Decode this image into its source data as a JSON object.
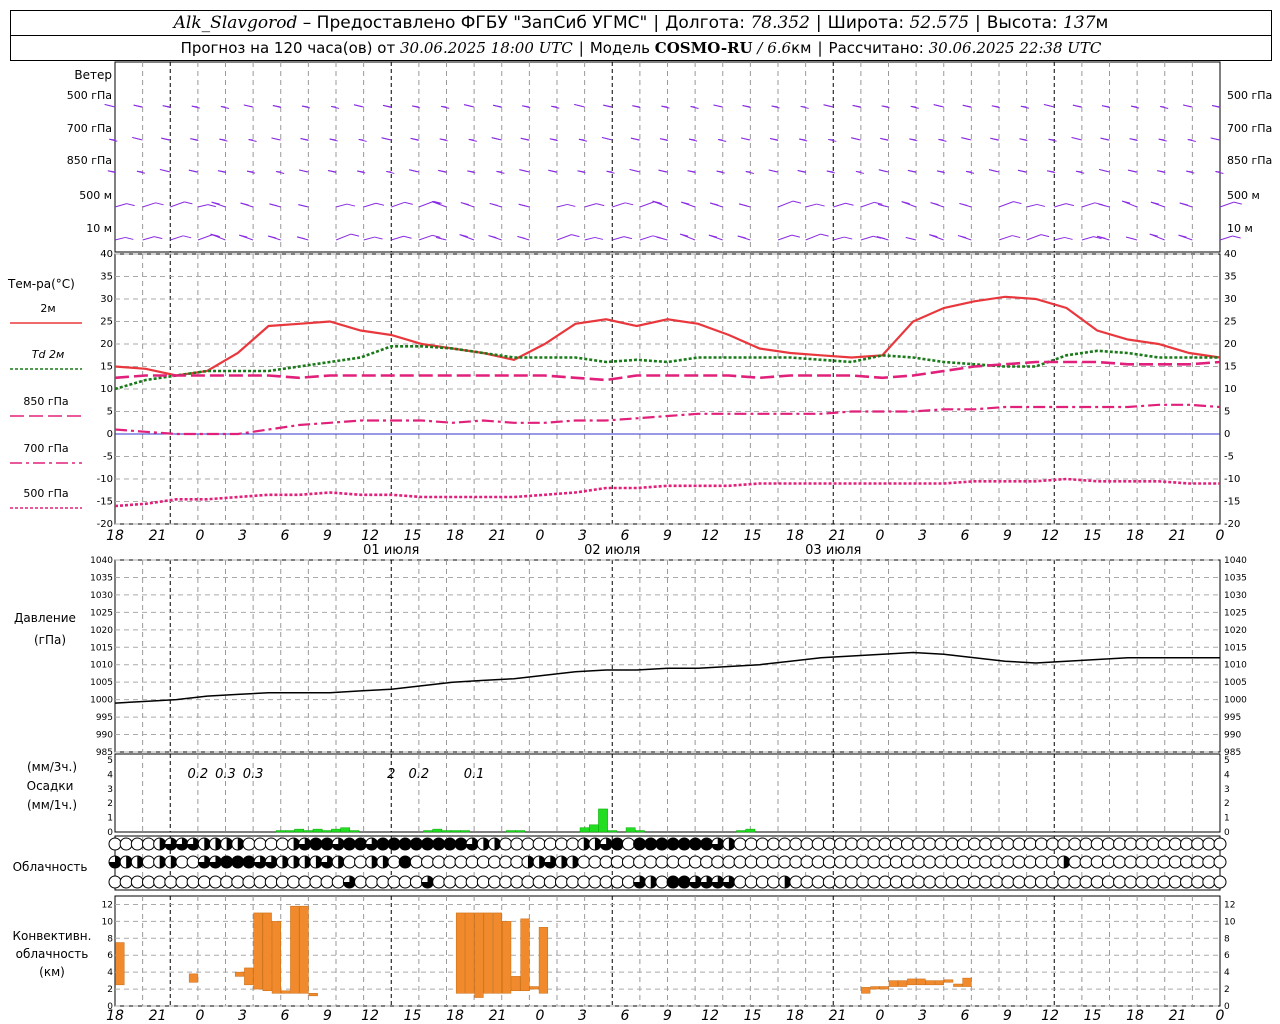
{
  "header": {
    "station": "Alk_Slavgorod",
    "provider": "– Предоставлено ФГБУ \"ЗапСиб УГМС\"",
    "lon_label": "Долгота:",
    "lon_value": "78.352",
    "lat_label": "Широта:",
    "lat_value": "52.575",
    "alt_label": "Высота:",
    "alt_value": "137",
    "alt_unit": "м",
    "forecast_label": "Прогноз на 120 часа(ов) от",
    "forecast_start": "30.06.2025 18:00 UTC",
    "model_label": "Модель",
    "model_name": "COSMO-RU",
    "model_res": "/ 6.6",
    "model_res_unit": "км",
    "computed_label": "Рассчитано:",
    "computed_value": "30.06.2025 22:38 UTC"
  },
  "labels": {
    "wind": "Ветер",
    "wind_levels": [
      "500 гПа",
      "700 гПа",
      "850 гПа",
      "500 м",
      "10  м"
    ],
    "temp_title": "Тем-ра(°C)",
    "temp_legend": [
      "2м",
      "Td  2м",
      "850 гПа",
      "700 гПа",
      "500 гПа"
    ],
    "pressure_title": "Давление",
    "pressure_unit": "(гПа)",
    "precip_unit3": "(мм/3ч.)",
    "precip_title": "Осадки",
    "precip_unit1": "(мм/1ч.)",
    "cloud_title": "Облачность",
    "conv_title": [
      "Конвективн.",
      "облачность",
      "(км)"
    ],
    "time_ticks": [
      "18",
      "21",
      "0",
      "3",
      "6",
      "9",
      "12",
      "15",
      "18",
      "21",
      "0",
      "3",
      "6",
      "9",
      "12",
      "15",
      "18",
      "21",
      "0",
      "3",
      "6",
      "9",
      "12",
      "15",
      "18",
      "21",
      "0"
    ],
    "dates": [
      "01 июля",
      "02 июля",
      "03 июля"
    ],
    "precip_3h_labels": [
      "0.2",
      "0.3",
      "0.3",
      "2",
      "0.2",
      "0.1"
    ]
  },
  "colors": {
    "wind": "#8a2be2",
    "t2m": "#e8383d",
    "td2m": "#1a7a1a",
    "t850": "#e0207a",
    "t700": "#e0207a",
    "t500": "#e0207a",
    "precip": "#22dd22",
    "conv": "#f08a2c",
    "zero_line": "#3333cc"
  },
  "chart_data": [
    {
      "type": "line",
      "title": "Тем-ра(°C)",
      "ylim": [
        -20,
        40
      ],
      "x_hours_from_start": [
        0,
        3,
        6,
        9,
        12,
        15,
        18,
        21,
        24,
        27,
        30,
        33,
        36,
        39,
        42,
        45,
        48,
        51,
        54,
        57,
        60,
        63,
        66,
        69,
        72,
        75,
        78,
        81,
        84,
        87,
        90,
        93,
        96,
        99,
        102,
        105,
        108,
        111,
        114,
        117,
        120
      ],
      "series": [
        {
          "name": "2м",
          "values": [
            15,
            14.5,
            13,
            14,
            18,
            24,
            24.5,
            25,
            23,
            22,
            20,
            19,
            18,
            16.5,
            20,
            24.5,
            25.5,
            24,
            25.5,
            24.5,
            22,
            19,
            18,
            17.5,
            17,
            17.5,
            25,
            28,
            29.5,
            30.5,
            30,
            28,
            23,
            21,
            20,
            18,
            17
          ]
        },
        {
          "name": "Td  2м",
          "values": [
            10,
            12,
            13,
            14,
            14,
            14,
            15,
            16,
            17,
            19.5,
            19.5,
            19,
            18,
            17,
            17,
            17,
            16,
            16.5,
            16,
            17,
            17,
            17,
            17,
            16.5,
            16,
            17.5,
            17,
            16,
            15.5,
            15,
            15,
            17.5,
            18.5,
            18,
            17,
            17,
            17
          ]
        },
        {
          "name": "850 гПа",
          "values": [
            12.5,
            13,
            13,
            13,
            13,
            13,
            12.5,
            13,
            13,
            13,
            13,
            13,
            13,
            13,
            13,
            12.5,
            12,
            13,
            13,
            13,
            13,
            12.5,
            13,
            13,
            13,
            12.5,
            13,
            14,
            15,
            15.5,
            16,
            16,
            16,
            15.5,
            15.5,
            15.5,
            16
          ]
        },
        {
          "name": "700 гПа",
          "values": [
            1,
            0.5,
            0,
            0,
            0,
            1,
            2,
            2.5,
            3,
            3,
            3,
            2.5,
            3,
            2.5,
            2.5,
            3,
            3,
            3.5,
            4,
            4.5,
            4.5,
            4.5,
            4.5,
            4.5,
            5,
            5,
            5,
            5.5,
            5.5,
            6,
            6,
            6,
            6,
            6,
            6.5,
            6.5,
            6
          ]
        },
        {
          "name": "500 гПа",
          "values": [
            -16,
            -15.5,
            -14.5,
            -14.5,
            -14,
            -13.5,
            -13.5,
            -13,
            -13.5,
            -13.5,
            -14,
            -14,
            -14,
            -14,
            -13.5,
            -13,
            -12,
            -12,
            -11.5,
            -11.5,
            -11.5,
            -11,
            -11,
            -11,
            -11,
            -11,
            -11,
            -11,
            -10.5,
            -10.5,
            -10.5,
            -10,
            -10.5,
            -10.5,
            -10.5,
            -11,
            -11
          ]
        }
      ]
    },
    {
      "type": "line",
      "title": "Давление",
      "ylim": [
        985,
        1040
      ],
      "series": [
        {
          "name": "Давление",
          "values": [
            999,
            999.5,
            1000,
            1001,
            1001.5,
            1002,
            1002,
            1002,
            1002.5,
            1003,
            1004,
            1005,
            1005.5,
            1006,
            1007,
            1008,
            1008.5,
            1008.5,
            1009,
            1009,
            1009.5,
            1010,
            1011,
            1012,
            1012.5,
            1013,
            1013.5,
            1013,
            1012,
            1011,
            1010.5,
            1011,
            1011.5,
            1012,
            1012,
            1012,
            1012
          ]
        }
      ]
    },
    {
      "type": "bar",
      "title": "Осадки",
      "ylim": [
        0,
        5
      ],
      "hours": [
        18,
        19,
        20,
        21,
        22,
        23,
        24,
        25,
        26,
        34,
        35,
        36,
        37,
        38,
        43,
        44,
        51,
        52,
        53,
        54,
        56,
        57,
        68,
        69
      ],
      "values": [
        0.1,
        0.1,
        0.2,
        0.1,
        0.2,
        0.1,
        0.2,
        0.3,
        0.1,
        0.1,
        0.2,
        0.1,
        0.1,
        0.1,
        0.1,
        0.1,
        0.3,
        0.5,
        1.6,
        0.1,
        0.3,
        0.1,
        0.1,
        0.2
      ]
    },
    {
      "type": "bar",
      "title": "Конвективн. облачность (км)",
      "ylim": [
        0,
        13
      ],
      "bars": [
        {
          "h": 0,
          "bottom": 2.5,
          "top": 7.5
        },
        {
          "h": 8,
          "bottom": 2.8,
          "top": 3.8
        },
        {
          "h": 13,
          "bottom": 3.5,
          "top": 4
        },
        {
          "h": 14,
          "bottom": 2.5,
          "top": 4.5
        },
        {
          "h": 15,
          "bottom": 2,
          "top": 11
        },
        {
          "h": 16,
          "bottom": 1.8,
          "top": 11
        },
        {
          "h": 17,
          "bottom": 1.5,
          "top": 10
        },
        {
          "h": 18,
          "bottom": 1.5,
          "top": 1.8
        },
        {
          "h": 19,
          "bottom": 1.5,
          "top": 11.8
        },
        {
          "h": 20,
          "bottom": 1.5,
          "top": 11.8
        },
        {
          "h": 21,
          "bottom": 1.2,
          "top": 1.5
        },
        {
          "h": 37,
          "bottom": 1.5,
          "top": 11
        },
        {
          "h": 38,
          "bottom": 1.5,
          "top": 11
        },
        {
          "h": 39,
          "bottom": 1,
          "top": 11
        },
        {
          "h": 40,
          "bottom": 1.5,
          "top": 11
        },
        {
          "h": 41,
          "bottom": 1.5,
          "top": 11
        },
        {
          "h": 42,
          "bottom": 1.5,
          "top": 10
        },
        {
          "h": 43,
          "bottom": 1.8,
          "top": 3.5
        },
        {
          "h": 44,
          "bottom": 1.8,
          "top": 10.3
        },
        {
          "h": 45,
          "bottom": 2,
          "top": 2.3
        },
        {
          "h": 46,
          "bottom": 1.5,
          "top": 9.3
        },
        {
          "h": 81,
          "bottom": 1.5,
          "top": 2.2
        },
        {
          "h": 82,
          "bottom": 2,
          "top": 2.3
        },
        {
          "h": 83,
          "bottom": 2,
          "top": 2.3
        },
        {
          "h": 84,
          "bottom": 2.3,
          "top": 3
        },
        {
          "h": 85,
          "bottom": 2.3,
          "top": 3
        },
        {
          "h": 86,
          "bottom": 2.5,
          "top": 3.2
        },
        {
          "h": 87,
          "bottom": 2.5,
          "top": 3.2
        },
        {
          "h": 88,
          "bottom": 2.5,
          "top": 3
        },
        {
          "h": 89,
          "bottom": 2.5,
          "top": 3
        },
        {
          "h": 90,
          "bottom": 2.8,
          "top": 2.8
        },
        {
          "h": 91,
          "bottom": 2.3,
          "top": 2.5
        },
        {
          "h": 92,
          "bottom": 2.3,
          "top": 3.3
        }
      ]
    }
  ],
  "cloud_rows": {
    "row1": [
      0,
      0,
      0,
      0,
      1,
      2,
      2,
      2,
      1,
      1,
      1,
      1,
      0,
      0,
      0,
      0,
      1,
      2,
      3,
      3,
      2,
      3,
      3,
      2,
      3,
      3,
      3,
      3,
      3,
      3,
      3,
      3,
      2,
      1,
      1,
      0,
      0,
      0,
      0,
      0,
      0,
      0,
      1,
      1,
      2,
      3,
      0,
      3,
      3,
      3,
      3,
      3,
      3,
      3,
      2,
      1,
      0,
      0,
      0,
      0,
      0,
      0,
      0,
      0,
      0,
      0,
      0,
      0,
      0,
      0,
      0,
      0,
      0,
      0,
      0,
      0,
      0,
      0,
      0,
      0,
      0,
      0,
      0,
      0,
      0,
      0,
      0,
      0,
      0,
      0,
      0,
      0,
      0,
      0,
      0,
      0,
      0,
      0,
      0,
      0
    ],
    "row2": [
      2,
      1,
      1,
      0,
      1,
      1,
      0,
      0,
      2,
      2,
      3,
      3,
      3,
      2,
      2,
      1,
      1,
      1,
      1,
      2,
      1,
      0,
      0,
      1,
      1,
      0,
      3,
      0,
      0,
      0,
      0,
      0,
      0,
      0,
      0,
      0,
      0,
      1,
      1,
      2,
      1,
      1,
      0,
      0,
      0,
      0,
      0,
      0,
      0,
      0,
      0,
      0,
      0,
      0,
      0,
      0,
      0,
      0,
      0,
      0,
      0,
      0,
      0,
      0,
      0,
      0,
      0,
      0,
      0,
      0,
      0,
      0,
      0,
      0,
      0,
      0,
      0,
      0,
      0,
      0,
      0,
      0,
      0,
      0,
      0,
      1,
      0,
      0,
      0,
      0,
      0,
      0,
      0,
      0,
      0,
      0,
      0,
      0,
      0,
      0
    ],
    "row3": [
      0,
      0,
      0,
      0,
      0,
      0,
      0,
      0,
      0,
      0,
      0,
      0,
      0,
      0,
      0,
      0,
      0,
      0,
      0,
      0,
      0,
      2,
      0,
      0,
      0,
      0,
      0,
      0,
      2,
      0,
      0,
      0,
      0,
      0,
      0,
      0,
      0,
      0,
      0,
      0,
      0,
      0,
      0,
      0,
      0,
      0,
      0,
      2,
      1,
      0,
      3,
      3,
      2,
      2,
      2,
      2,
      0,
      0,
      0,
      0,
      1,
      0,
      0,
      0,
      0,
      0,
      0,
      0,
      0,
      0,
      0,
      0,
      0,
      0,
      0,
      0,
      0,
      0,
      0,
      0,
      0,
      0,
      0,
      0,
      0,
      0,
      0,
      0,
      0,
      0,
      0,
      0,
      0,
      0,
      0,
      0,
      0,
      0,
      0,
      0
    ]
  }
}
